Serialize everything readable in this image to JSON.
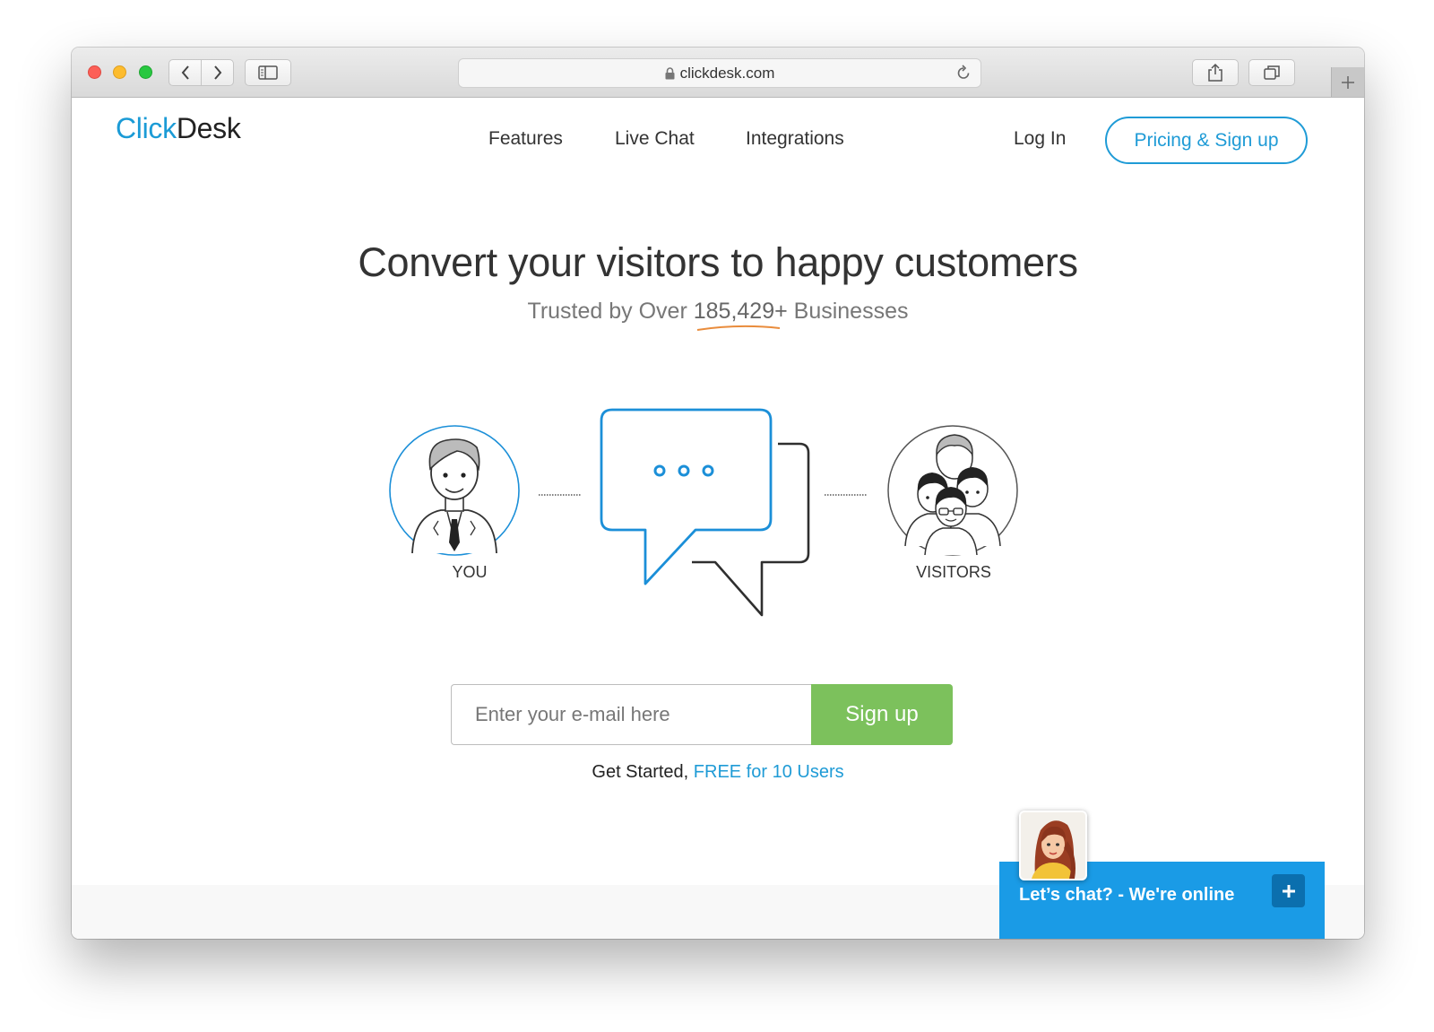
{
  "browser": {
    "url": "clickdesk.com"
  },
  "header": {
    "logo_part1": "Click",
    "logo_part2": "Desk",
    "nav": [
      "Features",
      "Live Chat",
      "Integrations"
    ],
    "login": "Log In",
    "pricing": "Pricing & Sign up"
  },
  "hero": {
    "title": "Convert your visitors to happy customers",
    "subtitle_prefix": "Trusted by Over ",
    "subtitle_count": "185,429+",
    "subtitle_suffix": " Businesses"
  },
  "illustration": {
    "you_label": "YOU",
    "visitors_label": "VISITORS",
    "accent_color": "#1b8fd8"
  },
  "signup": {
    "email_placeholder": "Enter your e-mail here",
    "button": "Sign up",
    "get_started": "Get Started, ",
    "free_link": "FREE for 10 Users",
    "button_color": "#7cc15c"
  },
  "chat_widget": {
    "text": "Let’s chat? - We're online",
    "color": "#1a9be6"
  },
  "icons": {
    "back": "chevron-left-icon",
    "forward": "chevron-right-icon",
    "sidebar": "sidebar-icon",
    "lock": "lock-icon",
    "reload": "reload-icon",
    "share": "share-icon",
    "tabs": "tabs-icon",
    "new_tab": "plus-icon",
    "chat_expand": "plus-icon"
  }
}
